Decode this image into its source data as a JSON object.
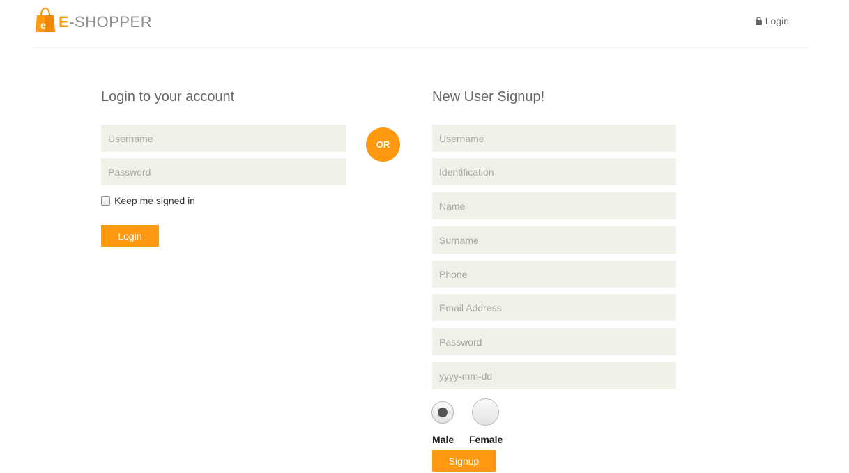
{
  "header": {
    "logo_text_prefix": "E",
    "logo_text_suffix": "-SHOPPER",
    "login_label": "Login"
  },
  "login": {
    "title": "Login to your account",
    "username_placeholder": "Username",
    "password_placeholder": "Password",
    "keep_signed_label": "Keep me signed in",
    "submit_label": "Login"
  },
  "or_label": "OR",
  "signup": {
    "title": "New User Signup!",
    "fields": {
      "username": "Username",
      "identification": "Identification",
      "name": "Name",
      "surname": "Surname",
      "phone": "Phone",
      "email": "Email Address",
      "password": "Password",
      "birthdate": "yyyy-mm-dd"
    },
    "gender": {
      "male_label": "Male",
      "female_label": "Female",
      "selected": "Male"
    },
    "submit_label": "Signup"
  },
  "colors": {
    "accent": "#FE980F",
    "field_bg": "#F0F0E9"
  }
}
